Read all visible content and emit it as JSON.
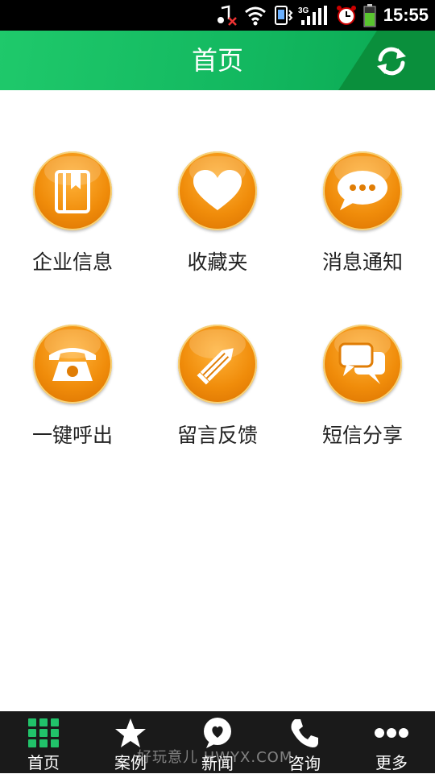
{
  "status_bar": {
    "time": "15:55",
    "network": "3G"
  },
  "header": {
    "title": "首页"
  },
  "grid": [
    {
      "label": "企业信息",
      "icon": "notebook-icon"
    },
    {
      "label": "收藏夹",
      "icon": "heart-icon"
    },
    {
      "label": "消息通知",
      "icon": "chat-bubble-icon"
    },
    {
      "label": "一键呼出",
      "icon": "telephone-icon"
    },
    {
      "label": "留言反馈",
      "icon": "pencil-icon"
    },
    {
      "label": "短信分享",
      "icon": "messages-icon"
    }
  ],
  "bottom_nav": [
    {
      "label": "首页",
      "icon": "grid-icon",
      "active": true
    },
    {
      "label": "案例",
      "icon": "star-icon"
    },
    {
      "label": "新闻",
      "icon": "news-bubble-icon"
    },
    {
      "label": "咨询",
      "icon": "phone-icon"
    },
    {
      "label": "更多",
      "icon": "more-icon"
    }
  ],
  "watermark": "好玩意儿 HWYX.COM",
  "colors": {
    "header_green": "#12b75f",
    "icon_orange": "#f08c0a",
    "nav_bg": "#1a1a1a",
    "active_green": "#1fc96b"
  }
}
